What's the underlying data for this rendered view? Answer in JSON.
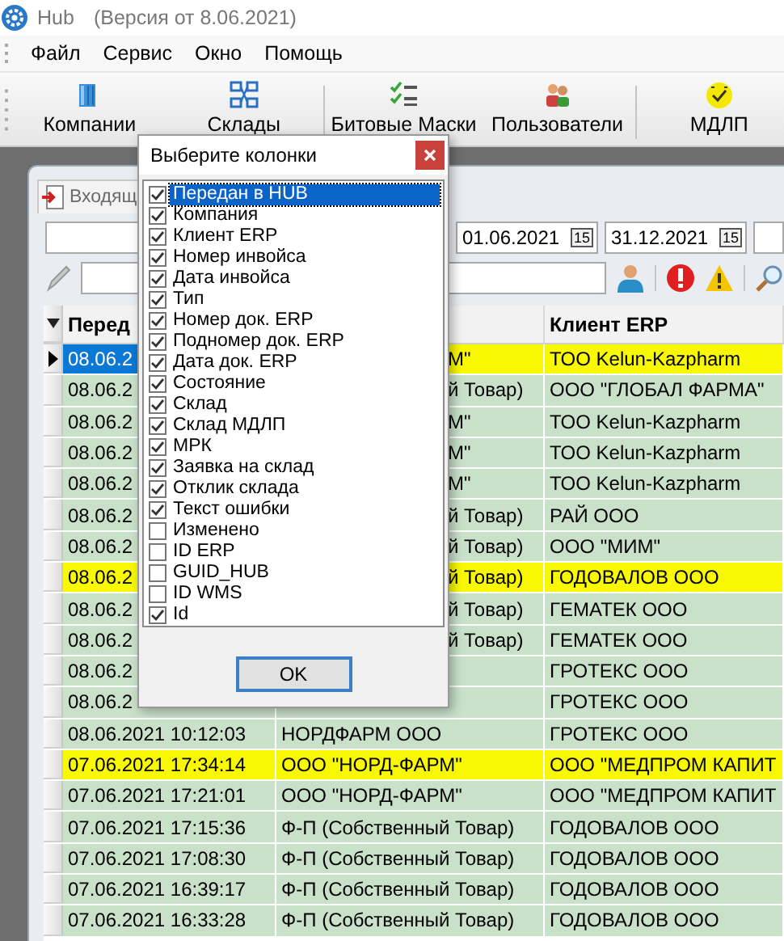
{
  "window": {
    "title": "Hub",
    "version": "(Версия от 8.06.2021)"
  },
  "menu": [
    {
      "label": "Файл"
    },
    {
      "label": "Сервис"
    },
    {
      "label": "Окно"
    },
    {
      "label": "Помощь"
    }
  ],
  "toolbar": [
    [
      {
        "label": "Компании"
      },
      {
        "label": "Склады"
      }
    ],
    [
      {
        "label": "Битовые Маски"
      },
      {
        "label": "Пользователи"
      }
    ],
    [
      {
        "label": "МДЛП"
      }
    ]
  ],
  "document": {
    "tab": "Входящ",
    "dates": [
      {
        "value": "01.06.2021",
        "calendar": "15"
      },
      {
        "value": "31.12.2021",
        "calendar": "15"
      }
    ]
  },
  "grid": {
    "columns": [
      {
        "label": "Перед"
      },
      {
        "label": "Клиент ERP"
      }
    ],
    "rows": [
      {
        "passed": "08.06.2",
        "company": "М\"",
        "client_erp": "ТОО Kelun-Kazpharm",
        "highlight": true,
        "selected": true,
        "covered": true
      },
      {
        "passed": "08.06.2",
        "company": "й Товар)",
        "client_erp": "ООО \"ГЛОБАЛ ФАРМА\"",
        "highlight": false,
        "selected": false,
        "covered": true
      },
      {
        "passed": "08.06.2",
        "company": "М\"",
        "client_erp": "ТОО Kelun-Kazpharm",
        "highlight": false,
        "selected": false,
        "covered": true
      },
      {
        "passed": "08.06.2",
        "company": "М\"",
        "client_erp": "ТОО Kelun-Kazpharm",
        "highlight": false,
        "selected": false,
        "covered": true
      },
      {
        "passed": "08.06.2",
        "company": "М\"",
        "client_erp": "ТОО Kelun-Kazpharm",
        "highlight": false,
        "selected": false,
        "covered": true
      },
      {
        "passed": "08.06.2",
        "company": "й Товар)",
        "client_erp": "РАЙ ООО",
        "highlight": false,
        "selected": false,
        "covered": true
      },
      {
        "passed": "08.06.2",
        "company": "й Товар)",
        "client_erp": "ООО \"МИМ\"",
        "highlight": false,
        "selected": false,
        "covered": true
      },
      {
        "passed": "08.06.2",
        "company": "й Товар)",
        "client_erp": "ГОДОВАЛОВ ООО",
        "highlight": true,
        "selected": false,
        "covered": true
      },
      {
        "passed": "08.06.2",
        "company": "й Товар)",
        "client_erp": "ГЕМАТЕК ООО",
        "highlight": false,
        "selected": false,
        "covered": true
      },
      {
        "passed": "08.06.2",
        "company": "й Товар)",
        "client_erp": "ГЕМАТЕК ООО",
        "highlight": false,
        "selected": false,
        "covered": true
      },
      {
        "passed": "08.06.2",
        "client_erp": "ГРОТЕКС ООО",
        "highlight": false,
        "selected": false
      },
      {
        "passed": "08.06.2",
        "client_erp": "ГРОТЕКС ООО",
        "highlight": false,
        "selected": false
      },
      {
        "passed": "08.06.2021 10:12:03",
        "company": "НОРДФАРМ ООО",
        "client_erp": "ГРОТЕКС ООО",
        "highlight": false,
        "selected": false,
        "covered": false
      },
      {
        "passed": "07.06.2021 17:34:14",
        "company": "ООО \"НОРД-ФАРМ\"",
        "client_erp": "ООО \"МЕДПРОМ КАПИТ",
        "highlight": true,
        "selected": false,
        "covered": false
      },
      {
        "passed": "07.06.2021 17:21:01",
        "company": "ООО \"НОРД-ФАРМ\"",
        "client_erp": "ООО \"МЕДПРОМ КАПИТ",
        "highlight": false,
        "selected": false,
        "covered": false
      },
      {
        "passed": "07.06.2021 17:15:36",
        "company": "Ф-П (Собственный Товар)",
        "client_erp": "ГОДОВАЛОВ ООО",
        "highlight": false,
        "selected": false,
        "covered": false
      },
      {
        "passed": "07.06.2021 17:08:30",
        "company": "Ф-П (Собственный Товар)",
        "client_erp": "ГОДОВАЛОВ ООО",
        "highlight": false,
        "selected": false,
        "covered": false
      },
      {
        "passed": "07.06.2021 16:39:17",
        "company": "Ф-П (Собственный Товар)",
        "client_erp": "ГОДОВАЛОВ ООО",
        "highlight": false,
        "selected": false,
        "covered": false
      },
      {
        "passed": "07.06.2021 16:33:28",
        "company": "Ф-П (Собственный Товар)",
        "client_erp": "ГОДОВАЛОВ ООО",
        "highlight": false,
        "selected": false,
        "covered": false
      }
    ]
  },
  "dialog": {
    "title": "Выберите колонки",
    "ok": "OK",
    "items": [
      {
        "label": "Передан в HUB",
        "checked": true,
        "selected": true
      },
      {
        "label": "Компания",
        "checked": true,
        "selected": false
      },
      {
        "label": "Клиент ERP",
        "checked": true,
        "selected": false
      },
      {
        "label": "Номер инвойса",
        "checked": true,
        "selected": false
      },
      {
        "label": "Дата инвойса",
        "checked": true,
        "selected": false
      },
      {
        "label": "Тип",
        "checked": true,
        "selected": false
      },
      {
        "label": "Номер док. ERP",
        "checked": true,
        "selected": false
      },
      {
        "label": "Подномер док. ERP",
        "checked": true,
        "selected": false
      },
      {
        "label": "Дата док. ERP",
        "checked": true,
        "selected": false
      },
      {
        "label": "Состояние",
        "checked": true,
        "selected": false
      },
      {
        "label": "Склад",
        "checked": true,
        "selected": false
      },
      {
        "label": "Склад МДЛП",
        "checked": true,
        "selected": false
      },
      {
        "label": "МРК",
        "checked": true,
        "selected": false
      },
      {
        "label": "Заявка на склад",
        "checked": true,
        "selected": false
      },
      {
        "label": "Отклик склада",
        "checked": true,
        "selected": false
      },
      {
        "label": "Текст ошибки",
        "checked": true,
        "selected": false
      },
      {
        "label": "Изменено",
        "checked": false,
        "selected": false
      },
      {
        "label": "ID ERP",
        "checked": false,
        "selected": false
      },
      {
        "label": "GUID_HUB",
        "checked": false,
        "selected": false
      },
      {
        "label": "ID WMS",
        "checked": false,
        "selected": false
      },
      {
        "label": "Id",
        "checked": true,
        "selected": false
      }
    ]
  }
}
